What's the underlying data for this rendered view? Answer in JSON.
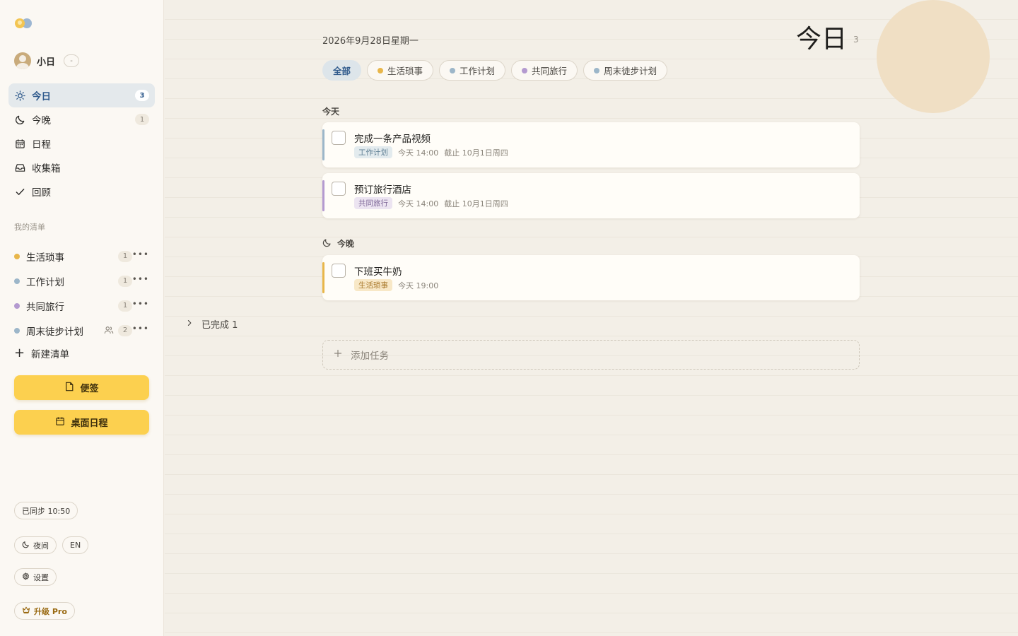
{
  "sidebar": {
    "user": {
      "name": "小日",
      "badge": "-"
    },
    "nav": [
      {
        "label": "今日",
        "count": "3",
        "icon": "sun-icon"
      },
      {
        "label": "今晚",
        "count": "1",
        "icon": "moon-icon"
      },
      {
        "label": "日程",
        "icon": "calendar-icon"
      },
      {
        "label": "收集箱",
        "icon": "inbox-icon"
      },
      {
        "label": "回顾",
        "icon": "check-icon"
      }
    ],
    "section_label": "我的清单",
    "lists": [
      {
        "label": "生活琐事",
        "count": "1",
        "color": "#e8b64a"
      },
      {
        "label": "工作计划",
        "count": "1",
        "color": "#9cb6c9"
      },
      {
        "label": "共同旅行",
        "count": "1",
        "color": "#b49ad0"
      },
      {
        "label": "周末徒步计划",
        "count": "2",
        "color": "#9cb6c9",
        "shared": true
      }
    ],
    "new_list_label": "新建清单",
    "note_button": "便签",
    "desktop_calendar_button": "桌面日程",
    "sync_status": "已同步 10:50",
    "night_mode": "夜间",
    "language": "EN",
    "settings": "设置",
    "upgrade": "升级 Pro"
  },
  "main": {
    "date": "2026年9月28日星期一",
    "title": "今日",
    "title_count": "3",
    "filters": [
      {
        "label": "全部",
        "active": true
      },
      {
        "label": "生活琐事",
        "color": "#e8b64a"
      },
      {
        "label": "工作计划",
        "color": "#9cb6c9"
      },
      {
        "label": "共同旅行",
        "color": "#b49ad0"
      },
      {
        "label": "周末徒步计划",
        "color": "#9cb6c9"
      }
    ],
    "groups": {
      "today": "今天",
      "tonight": "今晚"
    },
    "tasks": [
      {
        "title": "完成一条产品视频",
        "tag": "工作计划",
        "time": "今天 14:00",
        "due": "截止 10月1日周四",
        "color": "#9cb6c9",
        "tag_bg": "#e3ebee",
        "tag_fg": "#5f7f94"
      },
      {
        "title": "预订旅行酒店",
        "tag": "共同旅行",
        "time": "今天 14:00",
        "due": "截止 10月1日周四",
        "color": "#b49ad0",
        "tag_bg": "#ece4f1",
        "tag_fg": "#7d6697"
      },
      {
        "title": "下班买牛奶",
        "tag": "生活琐事",
        "time": "今天 19:00",
        "due": "",
        "color": "#e8b64a",
        "tag_bg": "#f8e8c7",
        "tag_fg": "#a8782a"
      }
    ],
    "completed_label": "已完成 1",
    "add_task_label": "添加任务"
  }
}
